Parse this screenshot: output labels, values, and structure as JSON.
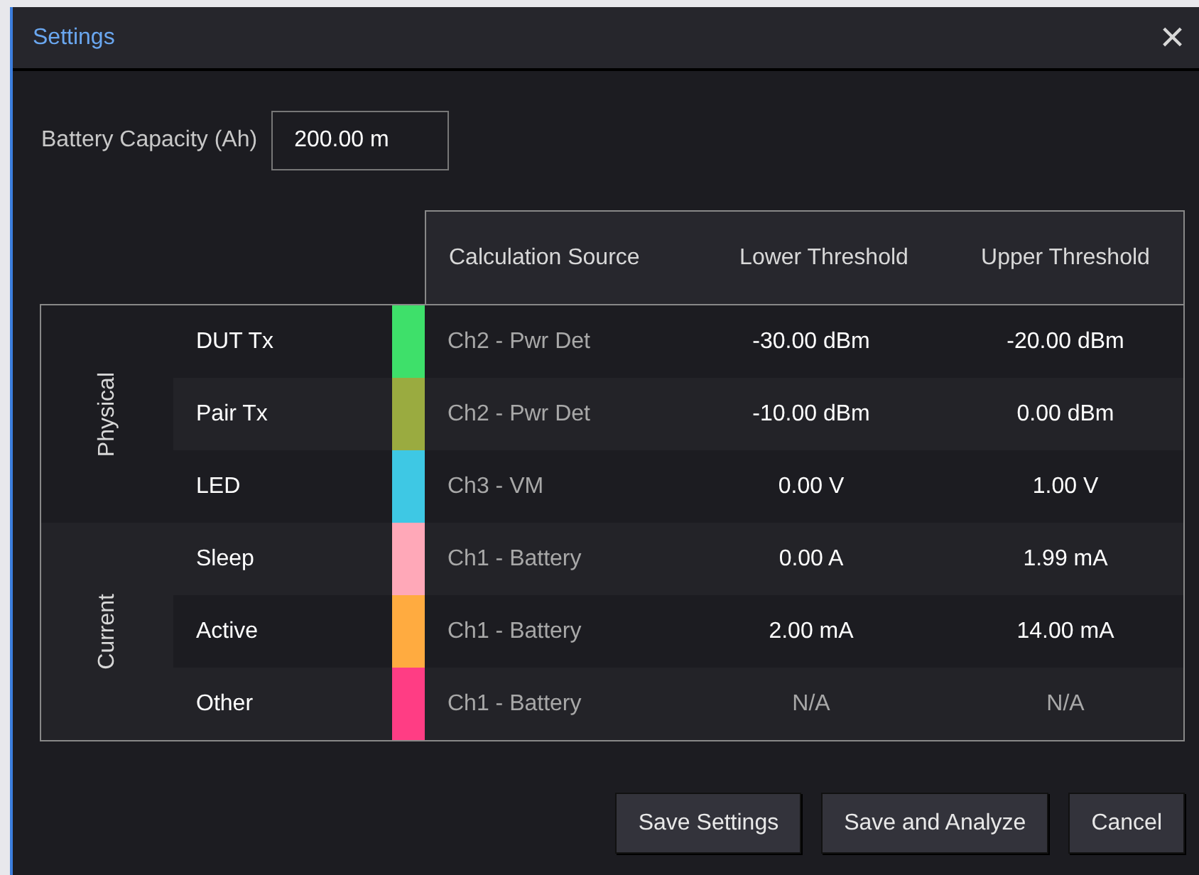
{
  "window": {
    "title": "Settings",
    "close": "×"
  },
  "battery_capacity": {
    "label": "Battery Capacity (Ah)",
    "value": "200.00 m"
  },
  "table": {
    "columns": [
      "Calculation Source",
      "Lower Threshold",
      "Upper Threshold"
    ],
    "groups": [
      {
        "name": "Physical",
        "rows": [
          {
            "name": "DUT Tx",
            "color": "#3ee06a",
            "source": "Ch2 - Pwr Det",
            "lower": "-30.00 dBm",
            "upper": "-20.00 dBm",
            "na": false
          },
          {
            "name": "Pair Tx",
            "color": "#9aab40",
            "source": "Ch2 - Pwr Det",
            "lower": "-10.00 dBm",
            "upper": "0.00 dBm",
            "na": false
          },
          {
            "name": "LED",
            "color": "#3ec8e4",
            "source": "Ch3 - VM",
            "lower": "0.00 V",
            "upper": "1.00 V",
            "na": false
          }
        ]
      },
      {
        "name": "Current",
        "rows": [
          {
            "name": "Sleep",
            "color": "#ffa8b8",
            "source": "Ch1 - Battery",
            "lower": "0.00 A",
            "upper": "1.99 mA",
            "na": false
          },
          {
            "name": "Active",
            "color": "#ffab40",
            "source": "Ch1 - Battery",
            "lower": "2.00 mA",
            "upper": "14.00 mA",
            "na": false
          },
          {
            "name": "Other",
            "color": "#ff3d84",
            "source": "Ch1 - Battery",
            "lower": "N/A",
            "upper": "N/A",
            "na": true
          }
        ]
      }
    ]
  },
  "buttons": [
    "Save Settings",
    "Save and Analyze",
    "Cancel"
  ]
}
